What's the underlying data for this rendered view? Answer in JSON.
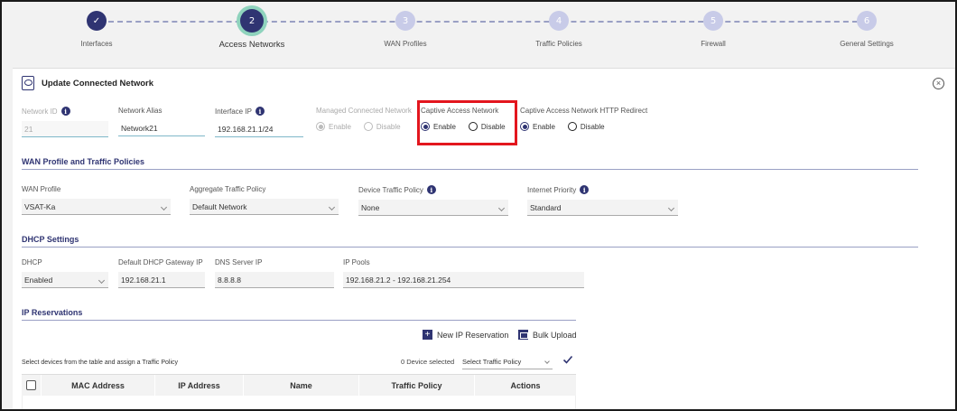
{
  "stepper": {
    "steps": [
      {
        "number": "✓",
        "label": "Interfaces",
        "state": "done"
      },
      {
        "number": "2",
        "label": "Access Networks",
        "state": "active"
      },
      {
        "number": "3",
        "label": "WAN Profiles",
        "state": "pending"
      },
      {
        "number": "4",
        "label": "Traffic Policies",
        "state": "pending"
      },
      {
        "number": "5",
        "label": "Firewall",
        "state": "pending"
      },
      {
        "number": "6",
        "label": "General Settings",
        "state": "pending"
      }
    ]
  },
  "panel": {
    "title": "Update Connected Network",
    "close_icon": "×"
  },
  "network": {
    "network_id_label": "Network ID",
    "network_id_value": "21",
    "alias_label": "Network Alias",
    "alias_value": "Network21",
    "interface_ip_label": "Interface IP",
    "interface_ip_value": "192.168.21.1/24",
    "managed_label": "Managed Connected Network",
    "managed_enable": "Enable",
    "managed_disable": "Disable",
    "captive_label": "Captive Access Network",
    "captive_enable": "Enable",
    "captive_disable": "Disable",
    "captive_redirect_label": "Captive Access Network HTTP Redirect",
    "redirect_enable": "Enable",
    "redirect_disable": "Disable"
  },
  "wan_section": {
    "title": "WAN Profile and Traffic Policies",
    "wan_profile_label": "WAN Profile",
    "wan_profile_value": "VSAT-Ka",
    "aggregate_label": "Aggregate Traffic Policy",
    "aggregate_value": "Default Network",
    "device_policy_label": "Device Traffic Policy",
    "device_policy_value": "None",
    "internet_priority_label": "Internet Priority",
    "internet_priority_value": "Standard"
  },
  "dhcp_section": {
    "title": "DHCP Settings",
    "dhcp_label": "DHCP",
    "dhcp_value": "Enabled",
    "gateway_label": "Default DHCP Gateway IP",
    "gateway_value": "192.168.21.1",
    "dns_label": "DNS Server IP",
    "dns_value": "8.8.8.8",
    "pools_label": "IP Pools",
    "pools_value": "192.168.21.2 - 192.168.21.254"
  },
  "reservations": {
    "title": "IP Reservations",
    "new_button": "New IP Reservation",
    "bulk_button": "Bulk Upload",
    "assign_text": "Select devices from the table and assign a Traffic Policy",
    "selected_count": "0 Device selected",
    "policy_select": "Select Traffic Policy",
    "columns": [
      "MAC Address",
      "IP Address",
      "Name",
      "Traffic Policy",
      "Actions"
    ]
  },
  "colors": {
    "primary": "#2f3472",
    "active_ring": "#8fd3bd",
    "highlight": "#e3161e"
  }
}
